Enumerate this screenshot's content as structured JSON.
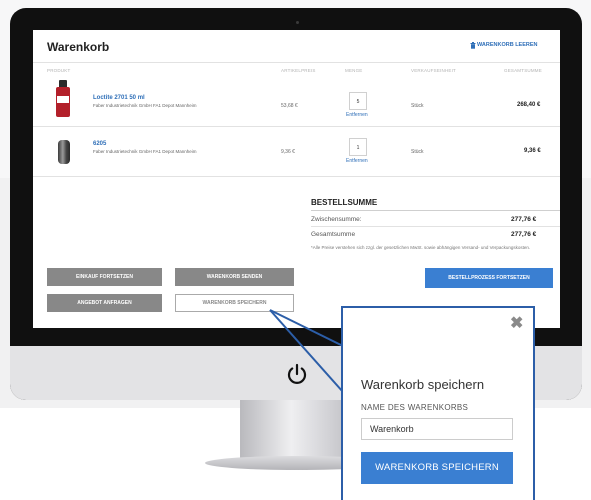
{
  "cart": {
    "title": "Warenkorb",
    "clear_label": "WARENKORB LEEREN",
    "columns": {
      "product": "PRODUKT",
      "unit_price": "ARTIKELPREIS",
      "quantity": "MENGE",
      "unit": "VERKAUFSEINHEIT",
      "total": "GESAMTSUMME"
    },
    "items": [
      {
        "name": "Loctite 2701 50 ml",
        "supplier": "Faber Industrietechnik GmbH FA1 Depot Mannheim",
        "price": "53,68 €",
        "qty": "5",
        "remove": "Entfernen",
        "unit": "Stück",
        "total": "268,40 €"
      },
      {
        "name": "6205",
        "supplier": "Faber Industrietechnik GmbH FA1 Depot Mannheim",
        "price": "9,36 €",
        "qty": "1",
        "remove": "Entfernen",
        "unit": "Stück",
        "total": "9,36 €"
      }
    ]
  },
  "summary": {
    "title": "BESTELLSUMME",
    "subtotal_label": "Zwischensumme:",
    "subtotal_value": "277,76 €",
    "total_label": "Gesamtsumme",
    "total_value": "277,76 €",
    "note": "*Alle Preise verstehen sich zzgl. der gesetzlichen MwSt. sowie abhängigen Versand- und Verpackungskosten."
  },
  "buttons": {
    "continue_shopping": "EINKAUF FORTSETZEN",
    "send_cart": "WARENKORB SENDEN",
    "request_quote": "ANGEBOT ANFRAGEN",
    "save_cart": "WARENKORB SPEICHERN",
    "checkout": "BESTELLPROZESS FORTSETZEN"
  },
  "popup": {
    "close_icon": "close-icon",
    "title": "Warenkorb speichern",
    "field_label": "NAME DES WARENKORBS",
    "field_value": "Warenkorb",
    "save_button": "WARENKORB SPEICHERN"
  },
  "icons": {
    "trash": "trash-icon",
    "power": "power-icon"
  },
  "colors": {
    "accent": "#3a7fd2",
    "link": "#2f6fb8",
    "popup_border": "#2c5ea8",
    "gray_button": "#888888",
    "product_bottle": "#b3202a"
  }
}
